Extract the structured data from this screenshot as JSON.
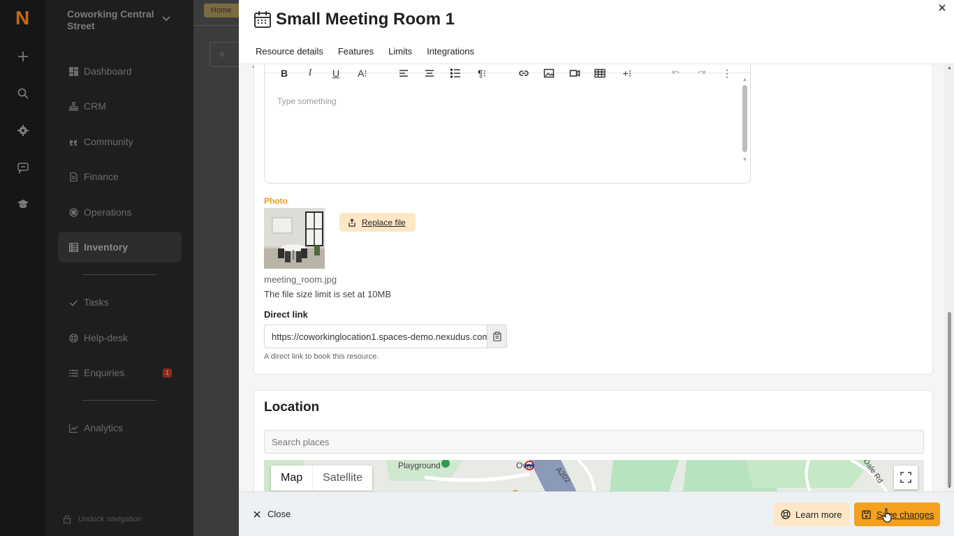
{
  "app": {
    "logo_letter": "N"
  },
  "workspace": {
    "name": "Coworking Central Street"
  },
  "sidebar": {
    "items": [
      {
        "label": "Dashboard",
        "icon": "dashboard-icon"
      },
      {
        "label": "CRM",
        "icon": "org-chart-icon"
      },
      {
        "label": "Community",
        "icon": "quote-icon"
      },
      {
        "label": "Finance",
        "icon": "document-icon"
      },
      {
        "label": "Operations",
        "icon": "cpu-icon"
      },
      {
        "label": "Inventory",
        "icon": "table-icon",
        "active": true
      },
      {
        "label": "Tasks",
        "icon": "check-icon"
      },
      {
        "label": "Help-desk",
        "icon": "lifebuoy-icon"
      },
      {
        "label": "Enquiries",
        "icon": "list-icon",
        "badge": "1"
      },
      {
        "label": "Analytics",
        "icon": "chart-icon"
      }
    ],
    "undock_label": "Undock navigation"
  },
  "background": {
    "breadcrumb_home": "Home"
  },
  "drawer": {
    "title": "Small Meeting Room 1",
    "tabs": [
      "Resource details",
      "Features",
      "Limits",
      "Integrations"
    ],
    "active_tab": "Resource details",
    "editor": {
      "placeholder": "Type something"
    },
    "photo": {
      "label": "Photo",
      "replace_label": "Replace file",
      "file_name": "meeting_room.jpg",
      "size_limit": "The file size limit is set at 10MB"
    },
    "direct_link": {
      "label": "Direct link",
      "value": "https://coworkinglocation1.spaces-demo.nexudus.com",
      "help": "A direct link to book this resource."
    },
    "location": {
      "title": "Location",
      "search_placeholder": "Search places",
      "map_tab": "Map",
      "satellite_tab": "Satellite",
      "map_labels": [
        "Playground",
        "Oval",
        "A202",
        "Dale Rd"
      ]
    },
    "footer": {
      "close_label": "Close",
      "learn_more_label": "Learn more",
      "save_label": "Save changes"
    }
  },
  "colors": {
    "accent": "#f5a01e",
    "accent_light": "#fde7c6",
    "photo_label": "#e59b1f",
    "logo": "#c46a10"
  }
}
